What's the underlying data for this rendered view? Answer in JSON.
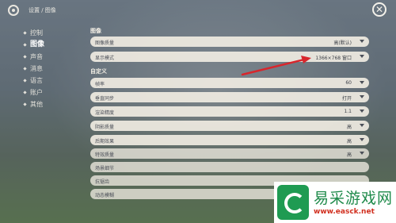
{
  "header": {
    "breadcrumb": "设置 / 图像",
    "close_symbol": "✕"
  },
  "sidebar": {
    "items": [
      {
        "label": "控制",
        "active": false
      },
      {
        "label": "图像",
        "active": true
      },
      {
        "label": "声音",
        "active": false
      },
      {
        "label": "消息",
        "active": false
      },
      {
        "label": "语言",
        "active": false
      },
      {
        "label": "账户",
        "active": false
      },
      {
        "label": "其他",
        "active": false
      }
    ]
  },
  "sections": {
    "image_title": "图像",
    "custom_title": "自定义"
  },
  "image_settings": [
    {
      "label": "图像质量",
      "value": "高(默认)"
    },
    {
      "label": "显示模式",
      "value": "1366×768 窗口"
    }
  ],
  "custom_settings": [
    {
      "label": "帧率",
      "value": "60"
    },
    {
      "label": "垂直同步",
      "value": "打开"
    },
    {
      "label": "渲染精度",
      "value": "1.1"
    },
    {
      "label": "阴影质量",
      "value": "高"
    },
    {
      "label": "后期效果",
      "value": "高"
    },
    {
      "label": "特效质量",
      "value": "高"
    },
    {
      "label": "场景细节",
      "value": ""
    },
    {
      "label": "抗锯齿",
      "value": ""
    },
    {
      "label": "动态模糊",
      "value": ""
    }
  ],
  "watermark": {
    "name": "易采游戏网",
    "url": "www.easck.net"
  },
  "colors": {
    "arrow": "#d8262c",
    "watermark_green": "#1e8a4a",
    "watermark_red": "#d12f1f"
  }
}
